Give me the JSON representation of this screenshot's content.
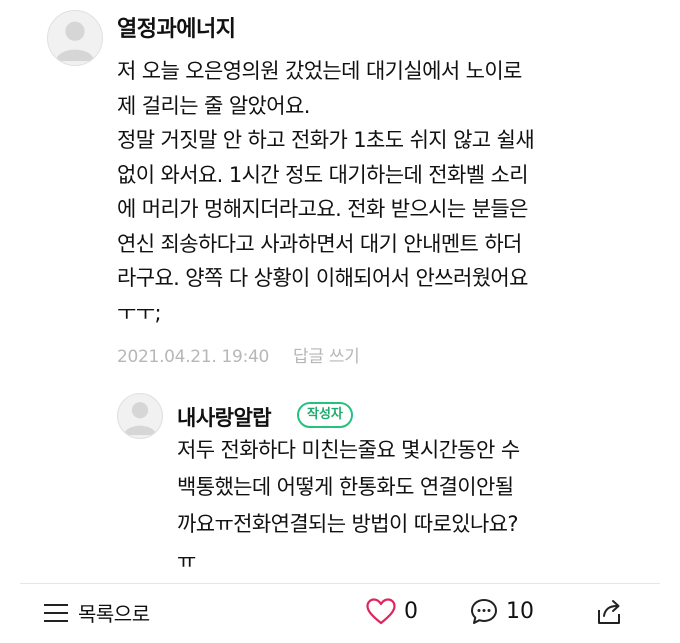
{
  "comment1": {
    "author": "열정과에너지",
    "lines": [
      "저 오늘 오은영의원 갔었는데 대기실에서 노이로",
      "제 걸리는 줄 알았어요.",
      "정말 거짓말 안 하고 전화가 1초도 쉬지 않고 쉴새",
      "없이 와서요. 1시간 정도 대기하는데 전화벨 소리",
      "에 머리가 멍해지더라고요. 전화 받으시는 분들은",
      "연신 죄송하다고 사과하면서 대기 안내멘트 하더",
      "라구요. 양쪽 다 상황이 이해되어서 안쓰러웠어요",
      "ㅜㅜ;"
    ],
    "timestamp": "2021.04.21. 19:40",
    "reply_label": "답글 쓰기"
  },
  "reply1": {
    "author": "내사랑알랍",
    "badge": "작성자",
    "lines": [
      "저두 전화하다 미친는줄요 몇시간동안 수",
      "백통했는데 어떻게 한통화도 연결이안될",
      "까요ㅠ전화연결되는 방법이 따로있나요?",
      "ㅠ"
    ]
  },
  "toolbar": {
    "list_label": "목록으로",
    "like_count": "0",
    "comment_count": "10"
  },
  "icons": {
    "list": "list-icon",
    "like": "heart-icon",
    "comment": "comment-bubble-icon",
    "share": "share-icon"
  },
  "colors": {
    "like": "#e0245e",
    "badge": "#25c27c",
    "meta": "#b7b7b7"
  }
}
